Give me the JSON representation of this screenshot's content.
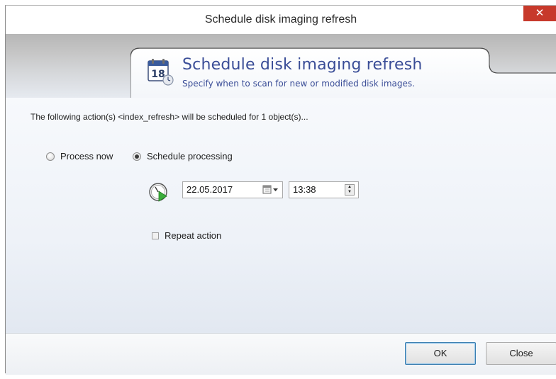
{
  "window": {
    "title": "Schedule disk imaging refresh",
    "close_glyph": "✕"
  },
  "header": {
    "title": "Schedule disk imaging refresh",
    "subtitle": "Specify when to scan for new or modified disk images.",
    "icon": "calendar-icon",
    "icon_day": "18"
  },
  "body": {
    "info_text": "The following action(s) <index_refresh> will be scheduled for 1 object(s)...",
    "process_now_label": "Process now",
    "schedule_label": "Schedule processing",
    "selected_option": "Schedule processing",
    "date_value": "22.05.2017",
    "time_value": "13:38",
    "repeat_label": "Repeat action",
    "repeat_checked": false
  },
  "footer": {
    "ok_label": "OK",
    "close_label": "Close"
  },
  "colors": {
    "header_text": "#3a4d97",
    "close_button": "#c7392b",
    "default_button_border": "#3c7fb1"
  }
}
